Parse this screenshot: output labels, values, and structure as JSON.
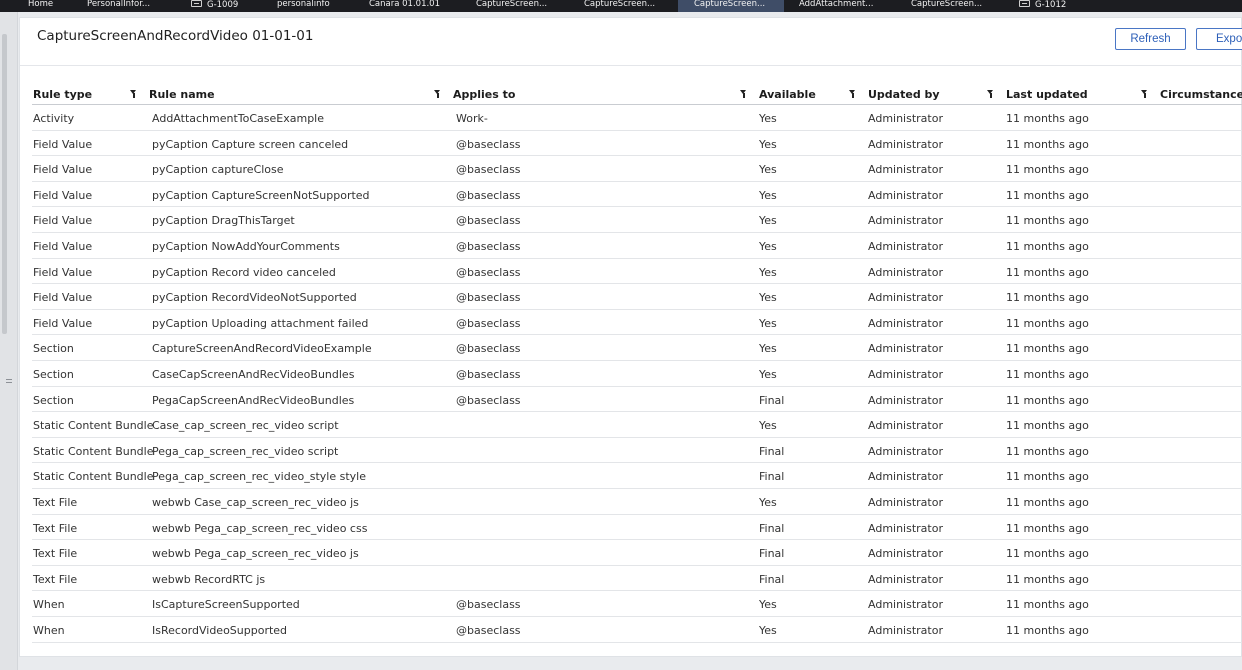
{
  "tabs": [
    {
      "label": "Home",
      "icon": null,
      "active": false
    },
    {
      "label": "PersonalInfor...",
      "icon": null,
      "active": false
    },
    {
      "label": "G-1009",
      "icon": "case-icon",
      "active": false
    },
    {
      "label": "personalinfo",
      "icon": null,
      "active": false
    },
    {
      "label": "Canara 01.01.01",
      "icon": null,
      "active": false
    },
    {
      "label": "CaptureScreen...",
      "icon": null,
      "active": false
    },
    {
      "label": "CaptureScreen...",
      "icon": null,
      "active": false
    },
    {
      "label": "CaptureScreen...",
      "icon": null,
      "active": true
    },
    {
      "label": "AddAttachment...",
      "icon": null,
      "active": false
    },
    {
      "label": "CaptureScreen...",
      "icon": null,
      "active": false
    },
    {
      "label": "G-1012",
      "icon": "case-icon",
      "active": false
    }
  ],
  "page": {
    "title": "CaptureScreenAndRecordVideo 01-01-01",
    "refresh_label": "Refresh",
    "export_label": "Export"
  },
  "table": {
    "columns": [
      "Rule type",
      "Rule name",
      "Applies to",
      "Available",
      "Updated by",
      "Last updated",
      "Circumstance"
    ],
    "rows": [
      [
        "Activity",
        "AddAttachmentToCaseExample",
        "Work-",
        "Yes",
        "Administrator",
        "11 months ago",
        ""
      ],
      [
        "Field Value",
        "pyCaption Capture screen canceled",
        "@baseclass",
        "Yes",
        "Administrator",
        "11 months ago",
        ""
      ],
      [
        "Field Value",
        "pyCaption captureClose",
        "@baseclass",
        "Yes",
        "Administrator",
        "11 months ago",
        ""
      ],
      [
        "Field Value",
        "pyCaption CaptureScreenNotSupported",
        "@baseclass",
        "Yes",
        "Administrator",
        "11 months ago",
        ""
      ],
      [
        "Field Value",
        "pyCaption DragThisTarget",
        "@baseclass",
        "Yes",
        "Administrator",
        "11 months ago",
        ""
      ],
      [
        "Field Value",
        "pyCaption NowAddYourComments",
        "@baseclass",
        "Yes",
        "Administrator",
        "11 months ago",
        ""
      ],
      [
        "Field Value",
        "pyCaption Record video canceled",
        "@baseclass",
        "Yes",
        "Administrator",
        "11 months ago",
        ""
      ],
      [
        "Field Value",
        "pyCaption RecordVideoNotSupported",
        "@baseclass",
        "Yes",
        "Administrator",
        "11 months ago",
        ""
      ],
      [
        "Field Value",
        "pyCaption Uploading attachment failed",
        "@baseclass",
        "Yes",
        "Administrator",
        "11 months ago",
        ""
      ],
      [
        "Section",
        "CaptureScreenAndRecordVideoExample",
        "@baseclass",
        "Yes",
        "Administrator",
        "11 months ago",
        ""
      ],
      [
        "Section",
        "CaseCapScreenAndRecVideoBundles",
        "@baseclass",
        "Yes",
        "Administrator",
        "11 months ago",
        ""
      ],
      [
        "Section",
        "PegaCapScreenAndRecVideoBundles",
        "@baseclass",
        "Final",
        "Administrator",
        "11 months ago",
        ""
      ],
      [
        "Static Content Bundle",
        "Case_cap_screen_rec_video script",
        "",
        "Yes",
        "Administrator",
        "11 months ago",
        ""
      ],
      [
        "Static Content Bundle",
        "Pega_cap_screen_rec_video script",
        "",
        "Final",
        "Administrator",
        "11 months ago",
        ""
      ],
      [
        "Static Content Bundle",
        "Pega_cap_screen_rec_video_style style",
        "",
        "Final",
        "Administrator",
        "11 months ago",
        ""
      ],
      [
        "Text File",
        "webwb Case_cap_screen_rec_video js",
        "",
        "Yes",
        "Administrator",
        "11 months ago",
        ""
      ],
      [
        "Text File",
        "webwb Pega_cap_screen_rec_video css",
        "",
        "Final",
        "Administrator",
        "11 months ago",
        ""
      ],
      [
        "Text File",
        "webwb Pega_cap_screen_rec_video js",
        "",
        "Final",
        "Administrator",
        "11 months ago",
        ""
      ],
      [
        "Text File",
        "webwb RecordRTC js",
        "",
        "Final",
        "Administrator",
        "11 months ago",
        ""
      ],
      [
        "When",
        "IsCaptureScreenSupported",
        "@baseclass",
        "Yes",
        "Administrator",
        "11 months ago",
        ""
      ],
      [
        "When",
        "IsRecordVideoSupported",
        "@baseclass",
        "Yes",
        "Administrator",
        "11 months ago",
        ""
      ]
    ]
  },
  "colors": {
    "tabbar": "#1c1d21",
    "active_tab": "#3f4d67",
    "button_accent": "#2d5fb8"
  }
}
